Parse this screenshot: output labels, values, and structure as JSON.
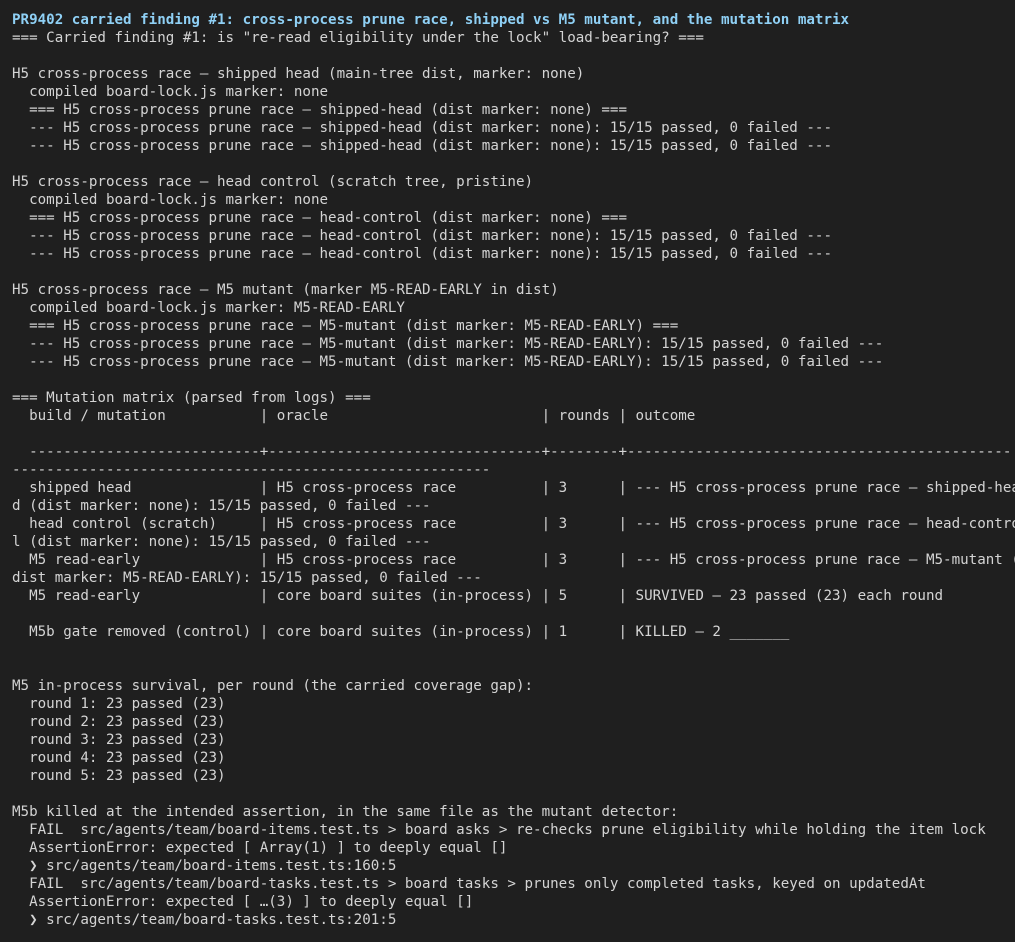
{
  "terminal": {
    "title": "PR9402 carried finding #1: cross-process prune race, shipped vs M5 mutant, and the mutation matrix",
    "lines": [
      "=== Carried finding #1: is \"re-read eligibility under the lock\" load-bearing? ===",
      "",
      "H5 cross-process race — shipped head (main-tree dist, marker: none)",
      "  compiled board-lock.js marker: none",
      "  === H5 cross-process prune race — shipped-head (dist marker: none) ===",
      "  --- H5 cross-process prune race — shipped-head (dist marker: none): 15/15 passed, 0 failed ---",
      "  --- H5 cross-process prune race — shipped-head (dist marker: none): 15/15 passed, 0 failed ---",
      "",
      "H5 cross-process race — head control (scratch tree, pristine)",
      "  compiled board-lock.js marker: none",
      "  === H5 cross-process prune race — head-control (dist marker: none) ===",
      "  --- H5 cross-process prune race — head-control (dist marker: none): 15/15 passed, 0 failed ---",
      "  --- H5 cross-process prune race — head-control (dist marker: none): 15/15 passed, 0 failed ---",
      "",
      "H5 cross-process race — M5 mutant (marker M5-READ-EARLY in dist)",
      "  compiled board-lock.js marker: M5-READ-EARLY",
      "  === H5 cross-process prune race — M5-mutant (dist marker: M5-READ-EARLY) ===",
      "  --- H5 cross-process prune race — M5-mutant (dist marker: M5-READ-EARLY): 15/15 passed, 0 failed ---",
      "  --- H5 cross-process prune race — M5-mutant (dist marker: M5-READ-EARLY): 15/15 passed, 0 failed ---",
      "",
      "=== Mutation matrix (parsed from logs) ===",
      "  build / mutation           | oracle                         | rounds | outcome",
      "",
      "  ---------------------------+--------------------------------+--------+---------------------------------------------",
      "--------------------------------------------------------",
      "  shipped head               | H5 cross-process race          | 3      | --- H5 cross-process prune race — shipped-hea",
      "d (dist marker: none): 15/15 passed, 0 failed ---",
      "  head control (scratch)     | H5 cross-process race          | 3      | --- H5 cross-process prune race — head-contro",
      "l (dist marker: none): 15/15 passed, 0 failed ---",
      "  M5 read-early              | H5 cross-process race          | 3      | --- H5 cross-process prune race — M5-mutant (",
      "dist marker: M5-READ-EARLY): 15/15 passed, 0 failed ---",
      "  M5 read-early              | core board suites (in-process) | 5      | SURVIVED — 23 passed (23) each round",
      "",
      "  M5b gate removed (control) | core board suites (in-process) | 1      | KILLED — 2 _______",
      "",
      "",
      "M5 in-process survival, per round (the carried coverage gap):",
      "  round 1: 23 passed (23)",
      "  round 2: 23 passed (23)",
      "  round 3: 23 passed (23)",
      "  round 4: 23 passed (23)",
      "  round 5: 23 passed (23)",
      "",
      "M5b killed at the intended assertion, in the same file as the mutant detector:",
      "  FAIL  src/agents/team/board-items.test.ts > board asks > re-checks prune eligibility while holding the item lock",
      "  AssertionError: expected [ Array(1) ] to deeply equal []",
      "  ❯ src/agents/team/board-items.test.ts:160:5",
      "  FAIL  src/agents/team/board-tasks.test.ts > board tasks > prunes only completed tasks, keyed on updatedAt",
      "  AssertionError: expected [ …(3) ] to deeply equal []",
      "  ❯ src/agents/team/board-tasks.test.ts:201:5"
    ]
  }
}
